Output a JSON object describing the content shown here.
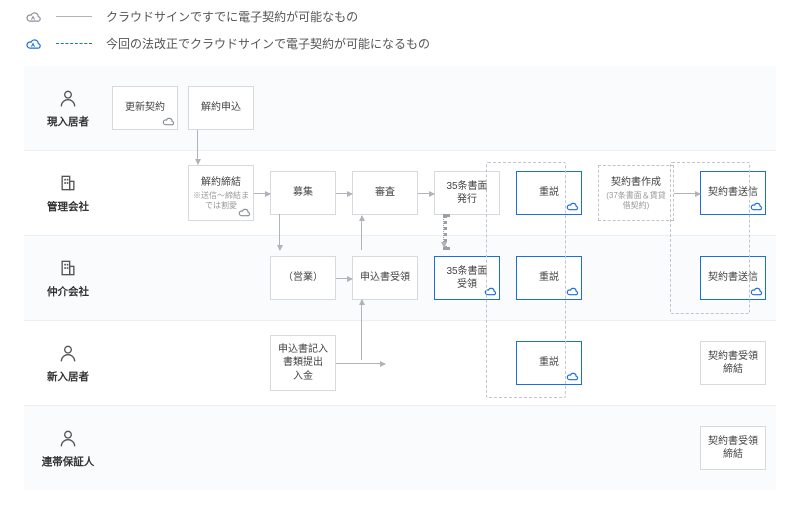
{
  "legend": {
    "gray_label": "クラウドサインですでに電子契約が可能なもの",
    "blue_label": "今回の法改正でクラウドサインで電子契約が可能になるもの"
  },
  "roles": {
    "current_resident": "現入居者",
    "management_company": "管理会社",
    "brokerage_company": "仲介会社",
    "new_resident": "新入居者",
    "guarantor": "連帯保証人"
  },
  "nodes": {
    "renewal_contract": "更新契約",
    "cancel_apply": "解約申込",
    "cancel_conclude": "解約締結",
    "cancel_conclude_sub": "※送信〜締結までは割愛",
    "recruit": "募集",
    "review": "審査",
    "art35_issue": "35条書面\n発行",
    "juusetsu": "重説",
    "contract_create": "契約書作成",
    "contract_create_sub": "(37条書面＆賃貸借契約)",
    "sales": "（営業）",
    "app_receipt": "申込書受領",
    "art35_receive": "35条書面\n受領",
    "contract_send": "契約書送信",
    "app_entry": "申込書記入\n書類提出\n入金",
    "contract_recv_conclude": "契約書受領\n締結"
  },
  "layout_cols": [
    0,
    76,
    158,
    240,
    322,
    404,
    496,
    588
  ]
}
